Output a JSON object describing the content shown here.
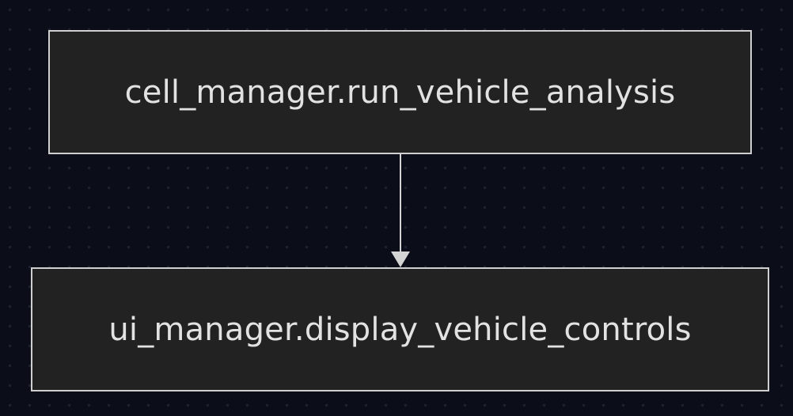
{
  "diagram": {
    "nodes": [
      {
        "id": "run_vehicle_analysis",
        "label": "cell_manager.run_vehicle_analysis"
      },
      {
        "id": "display_vehicle_controls",
        "label": "ui_manager.display_vehicle_controls"
      }
    ],
    "edges": [
      {
        "from": "run_vehicle_analysis",
        "to": "display_vehicle_controls"
      }
    ],
    "colors": {
      "background": "#0b0e18",
      "grid_dot": "#1e2230",
      "node_fill": "#222222",
      "node_border": "#cfcfcf",
      "text": "#e2e2e2",
      "edge": "#d4d4d4"
    }
  }
}
